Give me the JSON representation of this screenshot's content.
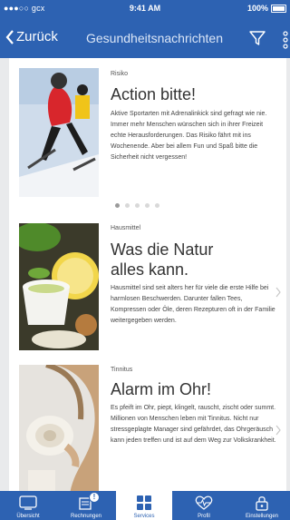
{
  "status_bar": {
    "carrier": "●●●○○ gcx",
    "time": "9:41 AM",
    "battery": "100%"
  },
  "nav": {
    "back_label": "Zurück",
    "title": "Gesundheitsnachrichten"
  },
  "articles": [
    {
      "category": "Risiko",
      "title_lines": [
        "Action bitte!"
      ],
      "body": "Aktive Sportarten mit Adrenalinkick sind gefragt wie nie. Immer mehr Menschen wünschen sich in ihrer Freizeit echte Herausforderungen. Das Risiko fährt mit ins Wochenende. Aber bei allem Fun und Spaß bitte die Sicherheit nicht vergessen!"
    },
    {
      "category": "Hausmittel",
      "title_lines": [
        "Was die Natur",
        "alles kann."
      ],
      "body": "Hausmittel sind seit alters her für viele die erste Hilfe bei harmlosen Beschwerden. Darunter fallen Tees, Kompressen oder Öle, deren Rezepturen oft in der Familie weitergegeben werden."
    },
    {
      "category": "Tinnitus",
      "title_lines": [
        "Alarm im Ohr!"
      ],
      "body": "Es pfeift im Ohr, piept, klingelt, rauscht, zischt oder summt. Millionen von Menschen leben mit Tinnitus. Nicht nur stressgeplagte Manager sind gefährdet, das Ohrgeräusch kann jeden treffen und ist auf dem Weg zur Volkskrankheit."
    }
  ],
  "carousel": {
    "count": 5,
    "active_index": 0
  },
  "tabs": [
    {
      "label": "Übersicht",
      "icon": "overview-icon"
    },
    {
      "label": "Rechnungen",
      "icon": "invoices-icon",
      "badge": "!"
    },
    {
      "label": "Services",
      "icon": "services-icon",
      "active": true
    },
    {
      "label": "Profil",
      "icon": "heart-pulse-icon"
    },
    {
      "label": "Einstellungen",
      "icon": "lock-icon"
    }
  ],
  "colors": {
    "brand_blue": "#2d62b2",
    "background": "#e9eaec"
  }
}
